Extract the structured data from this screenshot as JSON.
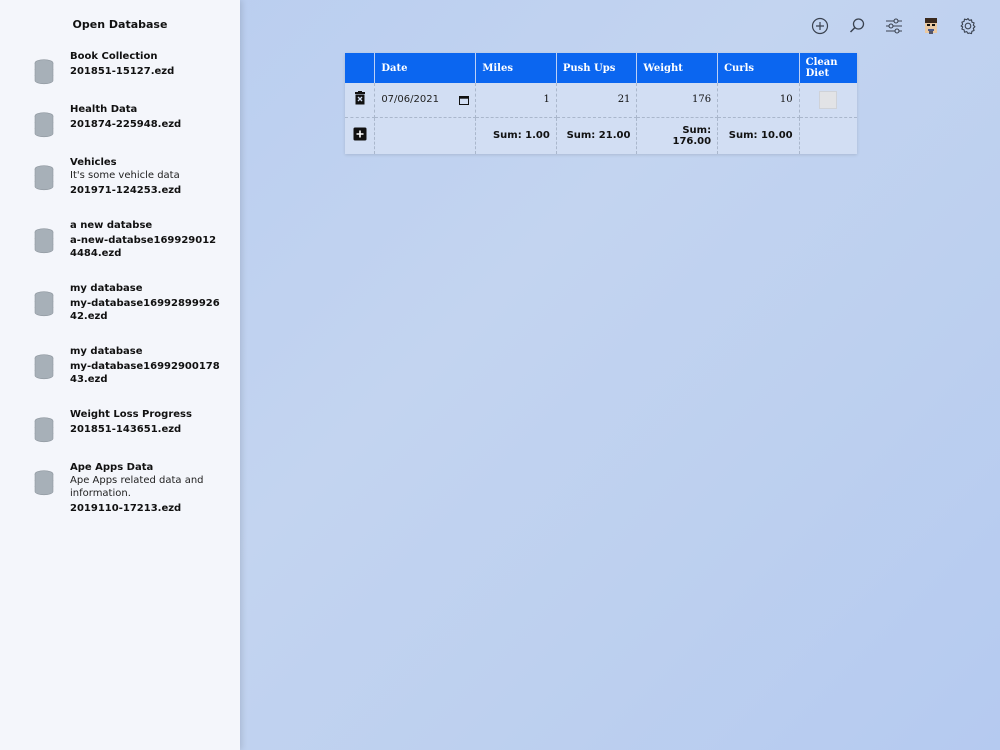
{
  "sidebar": {
    "title": "Open Database",
    "items": [
      {
        "name": "Book Collection",
        "desc": "",
        "file": "201851-15127.ezd"
      },
      {
        "name": "Health Data",
        "desc": "",
        "file": "201874-225948.ezd"
      },
      {
        "name": "Vehicles",
        "desc": "It's some vehicle data",
        "file": "201971-124253.ezd"
      },
      {
        "name": "a new databse",
        "desc": "",
        "file": "a-new-databse1699290124484.ezd"
      },
      {
        "name": "my database",
        "desc": "",
        "file": "my-database1699289992642.ezd"
      },
      {
        "name": "my database",
        "desc": "",
        "file": "my-database1699290017843.ezd"
      },
      {
        "name": "Weight Loss Progress",
        "desc": "",
        "file": "201851-143651.ezd"
      },
      {
        "name": "Ape Apps Data",
        "desc": "Ape Apps related data and information.",
        "file": "2019110-17213.ezd"
      }
    ]
  },
  "toolbar": {
    "icons": [
      "add-circle-icon",
      "search-icon",
      "sliders-icon",
      "avatar-icon",
      "gear-icon"
    ]
  },
  "table": {
    "headers": [
      "",
      "Date",
      "Miles",
      "Push Ups",
      "Weight",
      "Curls",
      "Clean Diet"
    ],
    "row": {
      "date": "07/06/2021",
      "miles": "1",
      "push_ups": "21",
      "weight": "176",
      "curls": "10"
    },
    "sums": {
      "miles": "Sum: 1.00",
      "push_ups": "Sum: 21.00",
      "weight": "Sum: 176.00",
      "curls": "Sum: 10.00"
    }
  },
  "colors": {
    "header_blue": "#0b66f0",
    "table_bg": "#d2def3",
    "sidebar_bg": "#f4f6fb"
  }
}
